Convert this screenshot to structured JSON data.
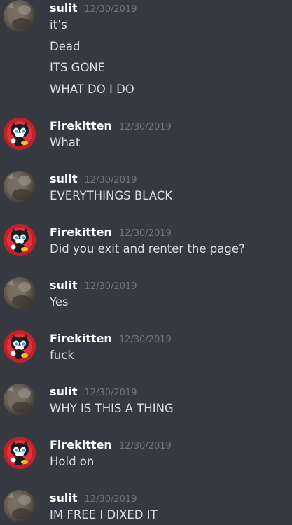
{
  "groups": [
    {
      "author": "sulit",
      "time": "12/30/2019",
      "avatar": "cat-photo-avatar",
      "lines": [
        "it’s",
        "Dead",
        "ITS GONE",
        "WHAT DO I DO"
      ]
    },
    {
      "author": "Firekitten",
      "time": "12/30/2019",
      "avatar": "cartoon-cat-avatar",
      "lines": [
        "What"
      ]
    },
    {
      "author": "sulit",
      "time": "12/30/2019",
      "avatar": "cat-photo-avatar",
      "lines": [
        "EVERYTHINGS BLACK"
      ]
    },
    {
      "author": "Firekitten",
      "time": "12/30/2019",
      "avatar": "cartoon-cat-avatar",
      "lines": [
        "Did you exit and renter the page?"
      ]
    },
    {
      "author": "sulit",
      "time": "12/30/2019",
      "avatar": "cat-photo-avatar",
      "lines": [
        "Yes"
      ]
    },
    {
      "author": "Firekitten",
      "time": "12/30/2019",
      "avatar": "cartoon-cat-avatar",
      "lines": [
        "fuck"
      ]
    },
    {
      "author": "sulit",
      "time": "12/30/2019",
      "avatar": "cat-photo-avatar",
      "lines": [
        "WHY IS THIS A THING"
      ]
    },
    {
      "author": "Firekitten",
      "time": "12/30/2019",
      "avatar": "cartoon-cat-avatar",
      "lines": [
        "Hold on"
      ]
    },
    {
      "author": "sulit",
      "time": "12/30/2019",
      "avatar": "cat-photo-avatar",
      "lines": [
        "IM FREE I DIXED IT"
      ]
    }
  ],
  "colors": {
    "background": "#36393f",
    "username": "#ffffff",
    "timestamp": "#72767d",
    "text": "#dcddde",
    "avatar_red": "#c4202a"
  }
}
